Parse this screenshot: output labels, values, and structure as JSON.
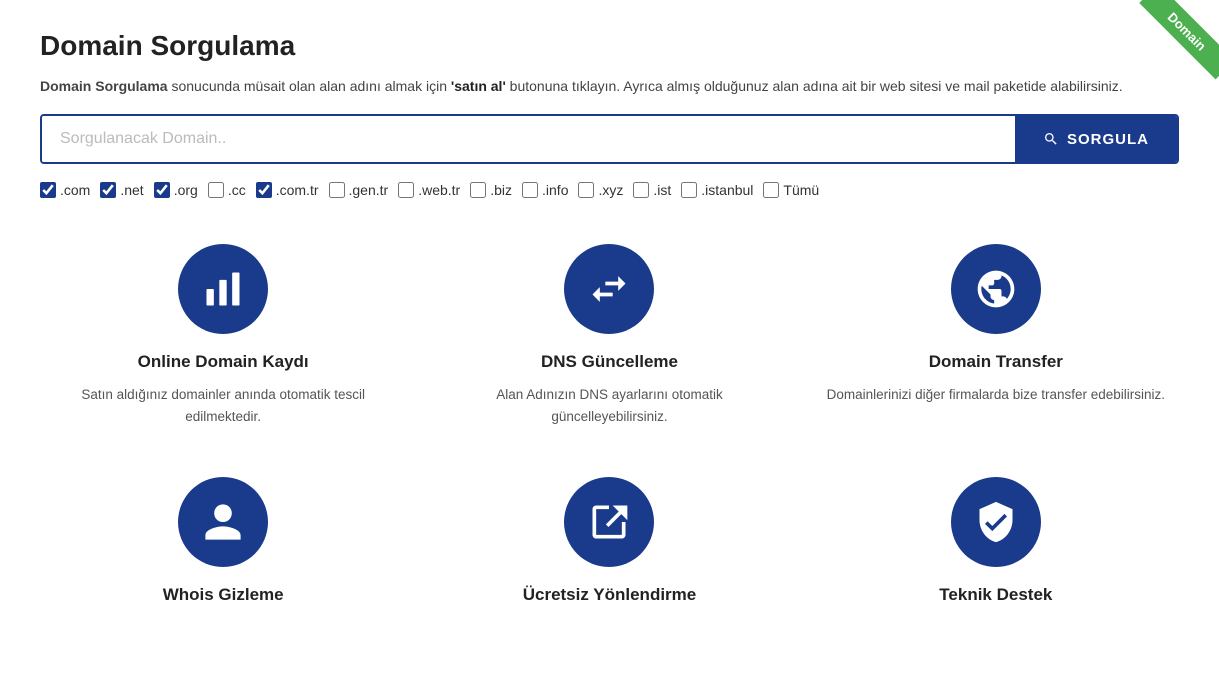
{
  "page": {
    "title": "Domain Sorgulama",
    "ribbon_label": "Domain",
    "subtitle_prefix": "Domain Sorgulama",
    "subtitle_text": " sonucunda müsait olan alan adını almak için ",
    "subtitle_cta": "'satın al'",
    "subtitle_suffix": " butonuna tıklayın. Ayrıca almış olduğunuz alan adına ait bir web sitesi ve mail paketide alabilirsiniz.",
    "search": {
      "placeholder": "Sorgulanacak Domain..",
      "button_label": "SORGULA"
    },
    "checkboxes": [
      {
        "label": ".com",
        "checked": true
      },
      {
        "label": ".net",
        "checked": true
      },
      {
        "label": ".org",
        "checked": true
      },
      {
        "label": ".cc",
        "checked": false
      },
      {
        "label": ".com.tr",
        "checked": true
      },
      {
        "label": ".gen.tr",
        "checked": false
      },
      {
        "label": ".web.tr",
        "checked": false
      },
      {
        "label": ".biz",
        "checked": false
      },
      {
        "label": ".info",
        "checked": false
      },
      {
        "label": ".xyz",
        "checked": false
      },
      {
        "label": ".ist",
        "checked": false
      },
      {
        "label": ".istanbul",
        "checked": false
      },
      {
        "label": "Tümü",
        "checked": false
      }
    ],
    "features": [
      {
        "id": "online-domain",
        "icon": "bar-chart",
        "title": "Online Domain Kaydı",
        "desc": "Satın aldığınız domainler anında otomatik tescil edilmektedir."
      },
      {
        "id": "dns-update",
        "icon": "arrows",
        "title": "DNS Güncelleme",
        "desc": "Alan Adınızın DNS ayarlarını otomatik güncelleyebilirsiniz."
      },
      {
        "id": "domain-transfer",
        "icon": "globe",
        "title": "Domain Transfer",
        "desc": "Domainlerinizi diğer firmalarda bize transfer edebilirsiniz."
      },
      {
        "id": "whois",
        "icon": "user",
        "title": "Whois Gizleme",
        "desc": ""
      },
      {
        "id": "redirect",
        "icon": "redirect",
        "title": "Ücretsiz Yönlendirme",
        "desc": ""
      },
      {
        "id": "support",
        "icon": "shield",
        "title": "Teknik Destek",
        "desc": ""
      }
    ]
  }
}
